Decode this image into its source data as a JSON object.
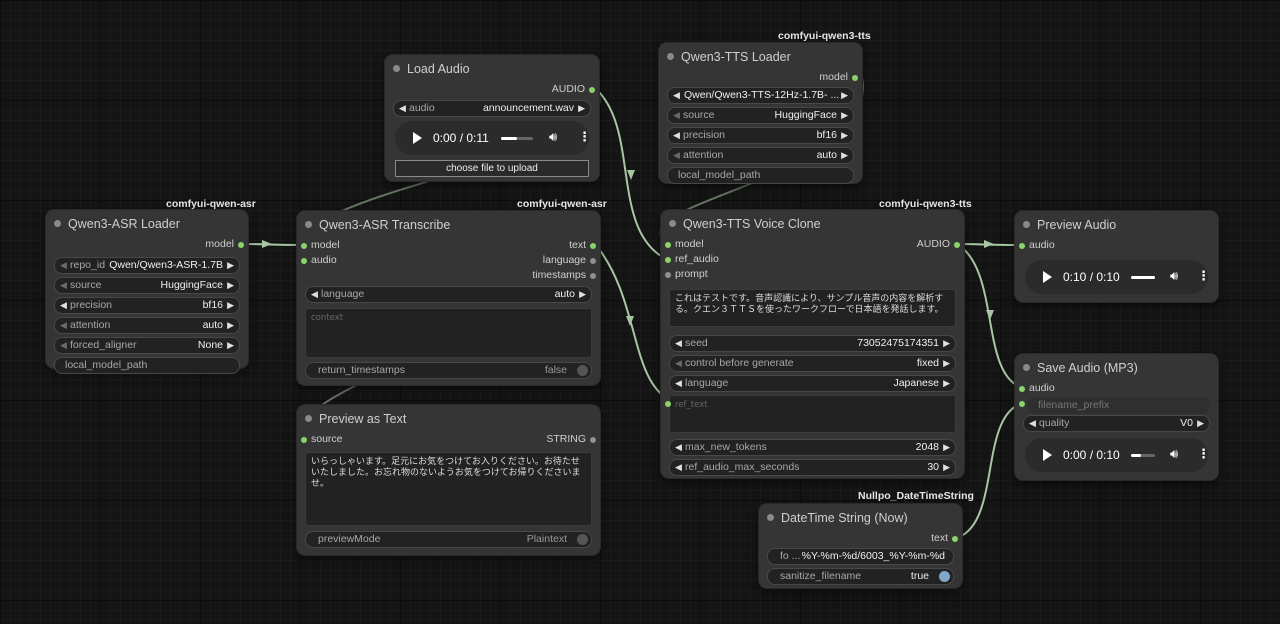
{
  "theme": {
    "connection": "#a8c6a2",
    "slot_float": "#8ad46a",
    "canvas": "#141414",
    "node": "#353535"
  },
  "nodes": {
    "asr_loader": {
      "badge": "comfyui-qwen-asr",
      "title": "Qwen3-ASR Loader",
      "output": "model",
      "widgets": [
        {
          "label": "repo_id",
          "value": "Qwen/Qwen3-ASR-1.7B"
        },
        {
          "label": "source",
          "value": "HuggingFace"
        },
        {
          "label": "precision",
          "value": "bf16"
        },
        {
          "label": "attention",
          "value": "auto"
        },
        {
          "label": "forced_aligner",
          "value": "None"
        }
      ],
      "text_widget": "local_model_path"
    },
    "load_audio": {
      "title": "Load Audio",
      "output": "AUDIO",
      "audio_label": "audio",
      "audio_value": "announcement.wav",
      "player_time": "0:00 / 0:11",
      "player_progress": 0.5,
      "upload_label": "choose file to upload"
    },
    "asr_transcribe": {
      "badge": "comfyui-qwen-asr",
      "title": "Qwen3-ASR Transcribe",
      "inputs": [
        "model",
        "audio"
      ],
      "outputs": [
        "text",
        "language",
        "timestamps"
      ],
      "language_label": "language",
      "language_value": "auto",
      "context_placeholder": "context",
      "toggle_label": "return_timestamps",
      "toggle_value": "false"
    },
    "preview_text": {
      "title": "Preview as Text",
      "input": "source",
      "output": "STRING",
      "text": "いらっしゃいます。足元にお気をつけてお入りください。お待たせいたしました。お忘れ物のないようお気をつけてお帰りくださいませ。",
      "toggle_label": "previewMode",
      "toggle_value": "Plaintext"
    },
    "tts_loader": {
      "badge": "comfyui-qwen3-tts",
      "title": "Qwen3-TTS Loader",
      "output": "model",
      "widgets": [
        {
          "label": "",
          "value": "Qwen/Qwen3-TTS-12Hz-1.7B- ..."
        },
        {
          "label": "source",
          "value": "HuggingFace"
        },
        {
          "label": "precision",
          "value": "bf16"
        },
        {
          "label": "attention",
          "value": "auto"
        }
      ],
      "text_widget": "local_model_path"
    },
    "voice_clone": {
      "badge": "comfyui-qwen3-tts",
      "title": "Qwen3-TTS Voice Clone",
      "inputs": [
        "model",
        "ref_audio",
        "prompt"
      ],
      "output": "AUDIO",
      "text": "これはテストです。音声認識により、サンプル音声の内容を解析する。クエン３ＴＴＳを使ったワークフローで日本語を発話します。",
      "widgets_a": [
        {
          "label": "seed",
          "value": "73052475174351"
        },
        {
          "label": "control before generate",
          "value": "fixed"
        },
        {
          "label": "language",
          "value": "Japanese"
        }
      ],
      "ref_text_placeholder": "ref_text",
      "widgets_b": [
        {
          "label": "max_new_tokens",
          "value": "2048"
        },
        {
          "label": "ref_audio_max_seconds",
          "value": "30"
        }
      ]
    },
    "preview_audio": {
      "title": "Preview Audio",
      "input": "audio",
      "player_time": "0:10 / 0:10",
      "player_progress": 1.0
    },
    "save_audio": {
      "title": "Save Audio (MP3)",
      "inputs": [
        "audio",
        "filename_prefix"
      ],
      "quality_label": "quality",
      "quality_value": "V0",
      "player_time": "0:00 / 0:10",
      "player_progress": 0.4
    },
    "datetime": {
      "badge": "Nullpo_DateTimeString",
      "title": "DateTime String (Now)",
      "output": "text",
      "format_label": "fo ...",
      "format_value": "%Y-%m-%d/6003_%Y-%m-%d",
      "toggle_label": "sanitize_filename",
      "toggle_value": "true"
    }
  }
}
